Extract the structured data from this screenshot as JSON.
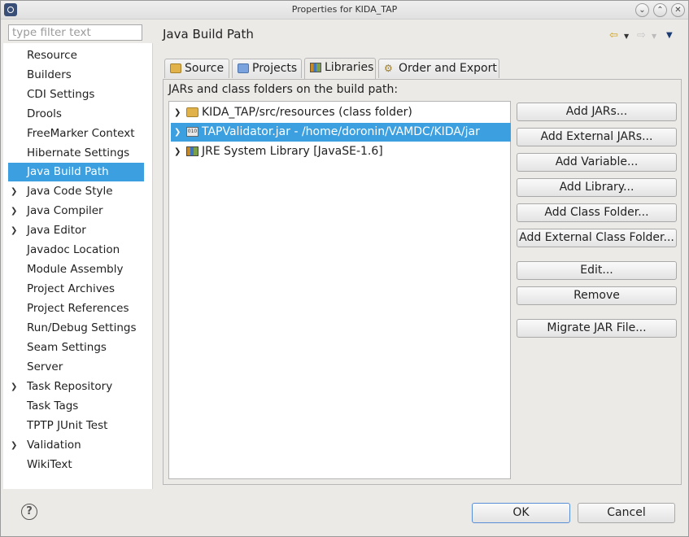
{
  "window": {
    "title": "Properties for KIDA_TAP",
    "controls": [
      "chevron-down",
      "chevron-up",
      "close"
    ]
  },
  "filter": {
    "placeholder": "type filter text"
  },
  "left_tree": {
    "items": [
      {
        "label": "Resource",
        "expandable": false
      },
      {
        "label": "Builders",
        "expandable": false
      },
      {
        "label": "CDI Settings",
        "expandable": false
      },
      {
        "label": "Drools",
        "expandable": false
      },
      {
        "label": "FreeMarker Context",
        "expandable": false
      },
      {
        "label": "Hibernate Settings",
        "expandable": false
      },
      {
        "label": "Java Build Path",
        "expandable": false,
        "selected": true
      },
      {
        "label": "Java Code Style",
        "expandable": true
      },
      {
        "label": "Java Compiler",
        "expandable": true
      },
      {
        "label": "Java Editor",
        "expandable": true
      },
      {
        "label": "Javadoc Location",
        "expandable": false
      },
      {
        "label": "Module Assembly",
        "expandable": false
      },
      {
        "label": "Project Archives",
        "expandable": false
      },
      {
        "label": "Project References",
        "expandable": false
      },
      {
        "label": "Run/Debug Settings",
        "expandable": false
      },
      {
        "label": "Seam Settings",
        "expandable": false
      },
      {
        "label": "Server",
        "expandable": false
      },
      {
        "label": "Task Repository",
        "expandable": true
      },
      {
        "label": "Task Tags",
        "expandable": false
      },
      {
        "label": "TPTP JUnit Test",
        "expandable": false
      },
      {
        "label": "Validation",
        "expandable": true
      },
      {
        "label": "WikiText",
        "expandable": false
      }
    ]
  },
  "page": {
    "title": "Java Build Path",
    "tabs": [
      {
        "label": "Source",
        "icon": "source-folder-icon"
      },
      {
        "label": "Projects",
        "icon": "projects-icon"
      },
      {
        "label": "Libraries",
        "icon": "libraries-icon",
        "active": true
      },
      {
        "label": "Order and Export",
        "icon": "order-export-icon"
      }
    ],
    "list_label": "JARs and class folders on the build path:",
    "entries": [
      {
        "label": "KIDA_TAP/src/resources (class folder)",
        "icon": "class-folder-icon"
      },
      {
        "label": "TAPValidator.jar - /home/doronin/VAMDC/KIDA/jar",
        "icon": "jar-icon",
        "selected": true
      },
      {
        "label": "JRE System Library [JavaSE-1.6]",
        "icon": "library-icon"
      }
    ],
    "buttons": [
      "Add JARs...",
      "Add External JARs...",
      "Add Variable...",
      "Add Library...",
      "Add Class Folder...",
      "Add External Class Folder...",
      "Edit...",
      "Remove",
      "Migrate JAR File..."
    ]
  },
  "footer": {
    "help": "?",
    "ok": "OK",
    "cancel": "Cancel"
  },
  "colors": {
    "selection": "#3b9fe0",
    "background": "#eceae7"
  }
}
